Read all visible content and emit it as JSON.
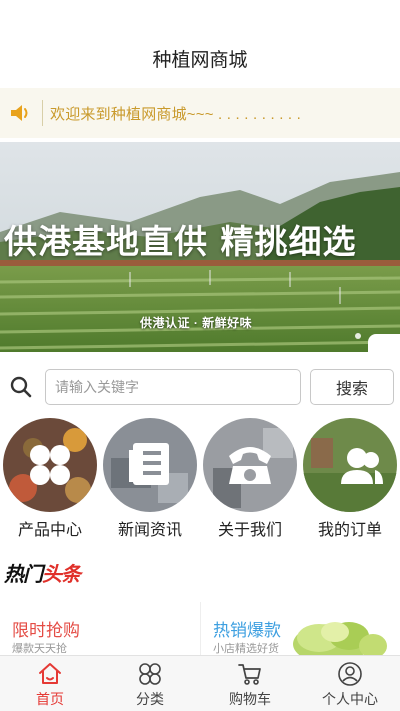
{
  "header": {
    "title": "种植网商城"
  },
  "notice": {
    "icon": "speaker-icon",
    "text": "欢迎来到种植网商城~~~ . . . . . . . . . ."
  },
  "banner": {
    "headline": "供港基地直供 精挑细选",
    "subtitle": "供港认证 · 新鲜好味"
  },
  "search": {
    "icon": "search-icon",
    "placeholder": "请输入关键字",
    "button_label": "搜索"
  },
  "categories": [
    {
      "label": "产品中心",
      "icon": "clover-icon"
    },
    {
      "label": "新闻资讯",
      "icon": "news-icon"
    },
    {
      "label": "关于我们",
      "icon": "phone-icon"
    },
    {
      "label": "我的订单",
      "icon": "users-icon"
    }
  ],
  "hot": {
    "part1": "热门",
    "part2": "头条"
  },
  "promos": [
    {
      "title": "限时抢购",
      "subtitle": "爆款天天抢"
    },
    {
      "title": "热销爆款",
      "subtitle": "小店精选好货"
    }
  ],
  "tabbar": [
    {
      "label": "首页",
      "icon": "home-icon",
      "active": true
    },
    {
      "label": "分类",
      "icon": "category-icon",
      "active": false
    },
    {
      "label": "购物车",
      "icon": "cart-icon",
      "active": false
    },
    {
      "label": "个人中心",
      "icon": "user-icon",
      "active": false
    }
  ],
  "colors": {
    "accent": "#e53935",
    "notice_text": "#c99a2c",
    "notice_bg": "#f9f7ee",
    "hot_red": "#e0302a",
    "promo_blue": "#3d9fe0"
  }
}
